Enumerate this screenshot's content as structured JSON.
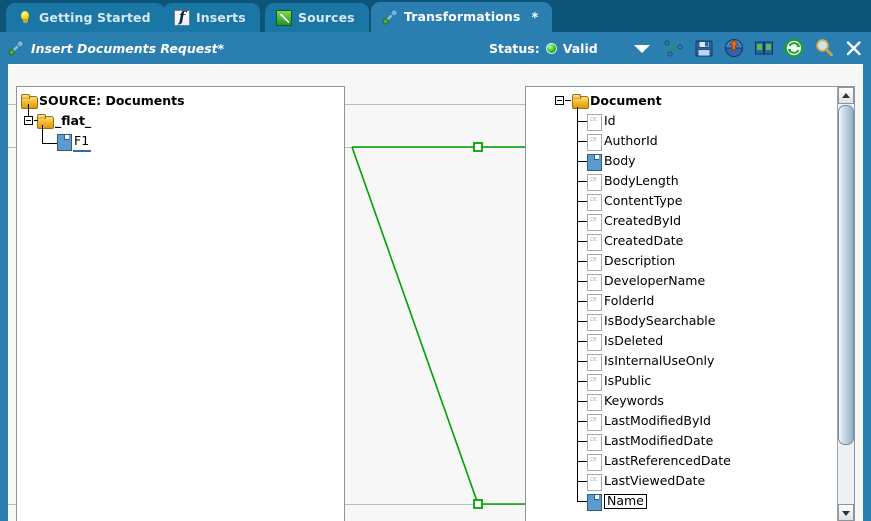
{
  "window": {
    "accent_color": "#2a7fb0",
    "tabbar_color": "#0c5478"
  },
  "tabs": [
    {
      "label": "Getting Started",
      "icon": "lightbulb-icon",
      "active": false,
      "modified": false
    },
    {
      "label": "Inserts",
      "icon": "inserts-icon",
      "active": false,
      "modified": false
    },
    {
      "label": "Sources",
      "icon": "sources-icon",
      "active": false,
      "modified": false
    },
    {
      "label": "Transformations",
      "icon": "transformations-icon",
      "active": true,
      "modified": true,
      "modified_marker": "*"
    }
  ],
  "titlebar": {
    "icon": "transformations-icon",
    "title": "Insert Documents Request*",
    "status_label": "Status:",
    "status_value": "Valid",
    "status_color": "#2fc01f",
    "dropdown_icon": "chevron-down-icon",
    "tools": [
      {
        "name": "graph-view-icon",
        "tooltip": "Graph"
      },
      {
        "name": "save-icon",
        "tooltip": "Save"
      },
      {
        "name": "deploy-icon",
        "tooltip": "Deploy"
      },
      {
        "name": "copy-icon",
        "tooltip": "Copy"
      },
      {
        "name": "refresh-icon",
        "tooltip": "Refresh"
      },
      {
        "name": "zoom-icon",
        "tooltip": "Zoom"
      },
      {
        "name": "close-icon",
        "tooltip": "Close"
      }
    ]
  },
  "source_tree": {
    "nodes": [
      {
        "label": "SOURCE: Documents",
        "type": "folder",
        "depth": 0,
        "bold": true,
        "expander": false
      },
      {
        "label": "_flat_",
        "type": "folder",
        "depth": 1,
        "bold": true,
        "expander": true
      },
      {
        "label": "F1",
        "type": "field",
        "depth": 2,
        "bold": false,
        "expander": false,
        "linked": true
      }
    ]
  },
  "target_tree": {
    "root": {
      "label": "Document",
      "type": "folder",
      "bold": true,
      "expander": true
    },
    "fields": [
      {
        "label": "Id",
        "type": "de"
      },
      {
        "label": "AuthorId",
        "type": "de"
      },
      {
        "label": "Body",
        "type": "mapped"
      },
      {
        "label": "BodyLength",
        "type": "de"
      },
      {
        "label": "ContentType",
        "type": "de"
      },
      {
        "label": "CreatedById",
        "type": "de"
      },
      {
        "label": "CreatedDate",
        "type": "de"
      },
      {
        "label": "Description",
        "type": "de"
      },
      {
        "label": "DeveloperName",
        "type": "de"
      },
      {
        "label": "FolderId",
        "type": "de"
      },
      {
        "label": "IsBodySearchable",
        "type": "de"
      },
      {
        "label": "IsDeleted",
        "type": "de"
      },
      {
        "label": "IsInternalUseOnly",
        "type": "de"
      },
      {
        "label": "IsPublic",
        "type": "de"
      },
      {
        "label": "Keywords",
        "type": "de"
      },
      {
        "label": "LastModifiedById",
        "type": "de"
      },
      {
        "label": "LastModifiedDate",
        "type": "de"
      },
      {
        "label": "LastReferencedDate",
        "type": "de"
      },
      {
        "label": "LastViewedDate",
        "type": "de"
      },
      {
        "label": "Name",
        "type": "mapped",
        "selected": true
      }
    ]
  },
  "connections": {
    "color": "#00a000",
    "links": [
      {
        "from": "F1",
        "to": "Body"
      },
      {
        "from": "F1",
        "to": "Name"
      }
    ]
  },
  "scrollbar": {
    "up_icon": "scroll-up-icon",
    "down_icon": "scroll-down-icon",
    "thumb": "scroll-thumb"
  }
}
